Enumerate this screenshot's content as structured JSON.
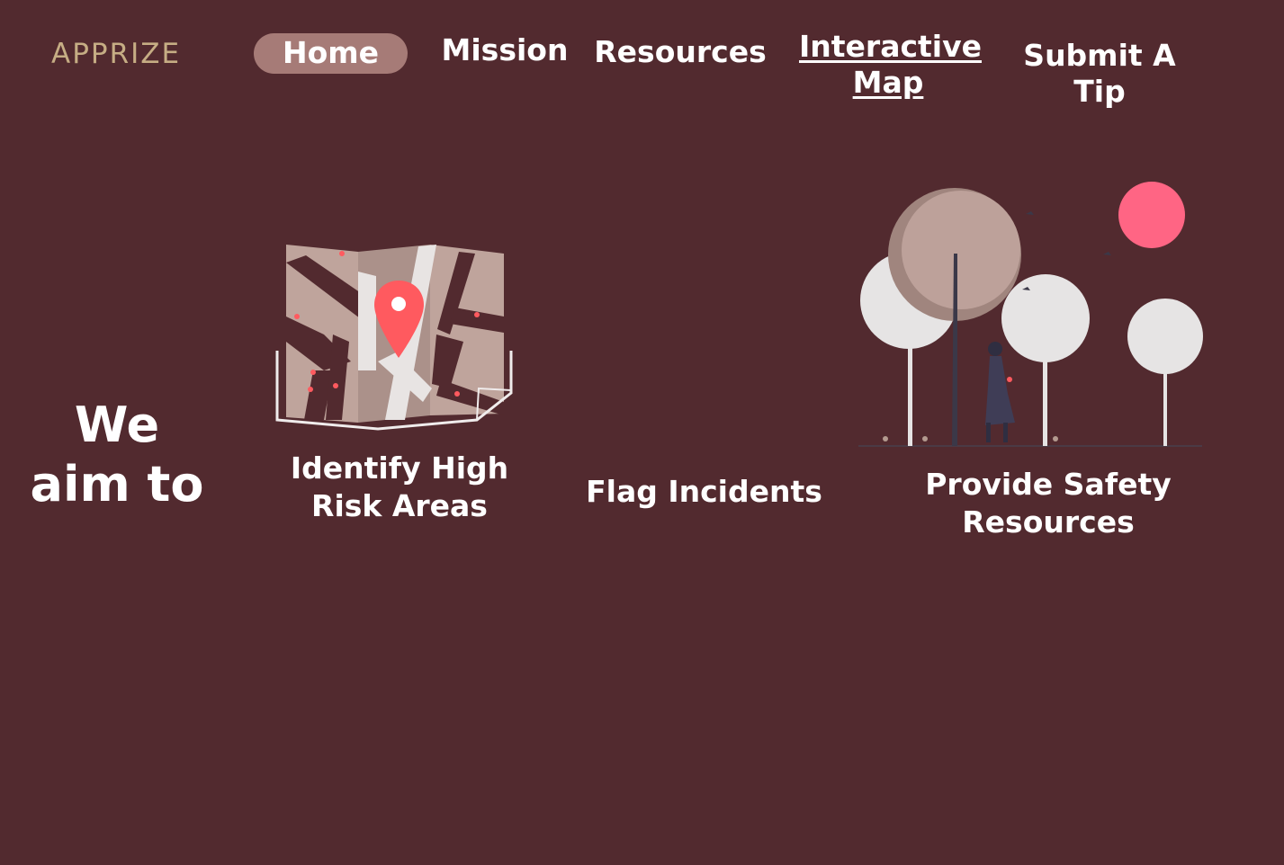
{
  "header": {
    "logo_text": "APPRIZE",
    "nav": {
      "home": "Home",
      "mission": "Mission",
      "resources": "Resources",
      "interactive_map_line1": "Interactive",
      "interactive_map_line2": "Map",
      "submit_tip": "Submit A Tip"
    }
  },
  "main": {
    "aim_line1": "We",
    "aim_line2": "aim to",
    "cards": [
      {
        "line1": "Identify High",
        "line2": "Risk Areas",
        "icon": "map-pin-illustration"
      },
      {
        "line1": "Flag Incidents",
        "icon": ""
      },
      {
        "line1": "Provide Safety",
        "line2": "Resources",
        "icon": "park-walk-illustration"
      }
    ]
  },
  "colors": {
    "background": "#522a2f",
    "logo": "#c6ad84",
    "active_nav": "#a67b77",
    "pin": "#ff5a5f",
    "sun": "#ff6584"
  }
}
